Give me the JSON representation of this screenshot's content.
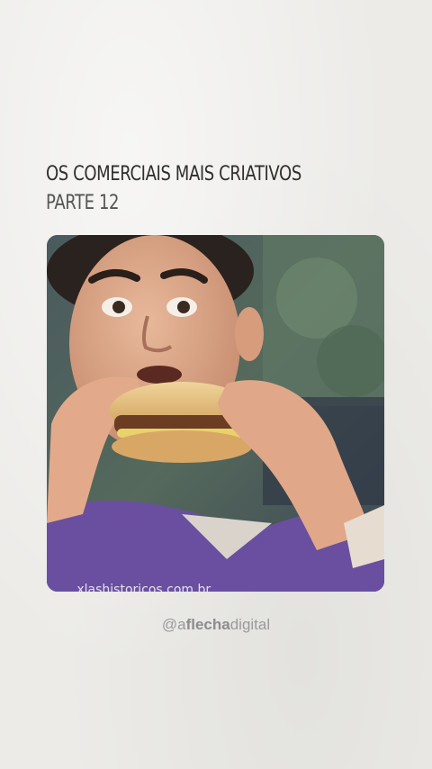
{
  "post": {
    "title": "OS COMERCIAIS MAIS CRIATIVOS",
    "subtitle": "PARTE 12"
  },
  "video": {
    "watermark": "...xlashistoricos.com.br"
  },
  "handle": {
    "at": "@a",
    "brand": "flecha",
    "suffix": "digital"
  },
  "colors": {
    "background": "#ecebe8",
    "title": "#2f2f2f",
    "handle": "#9a9a9a",
    "shirt": "#6a4fa0"
  }
}
